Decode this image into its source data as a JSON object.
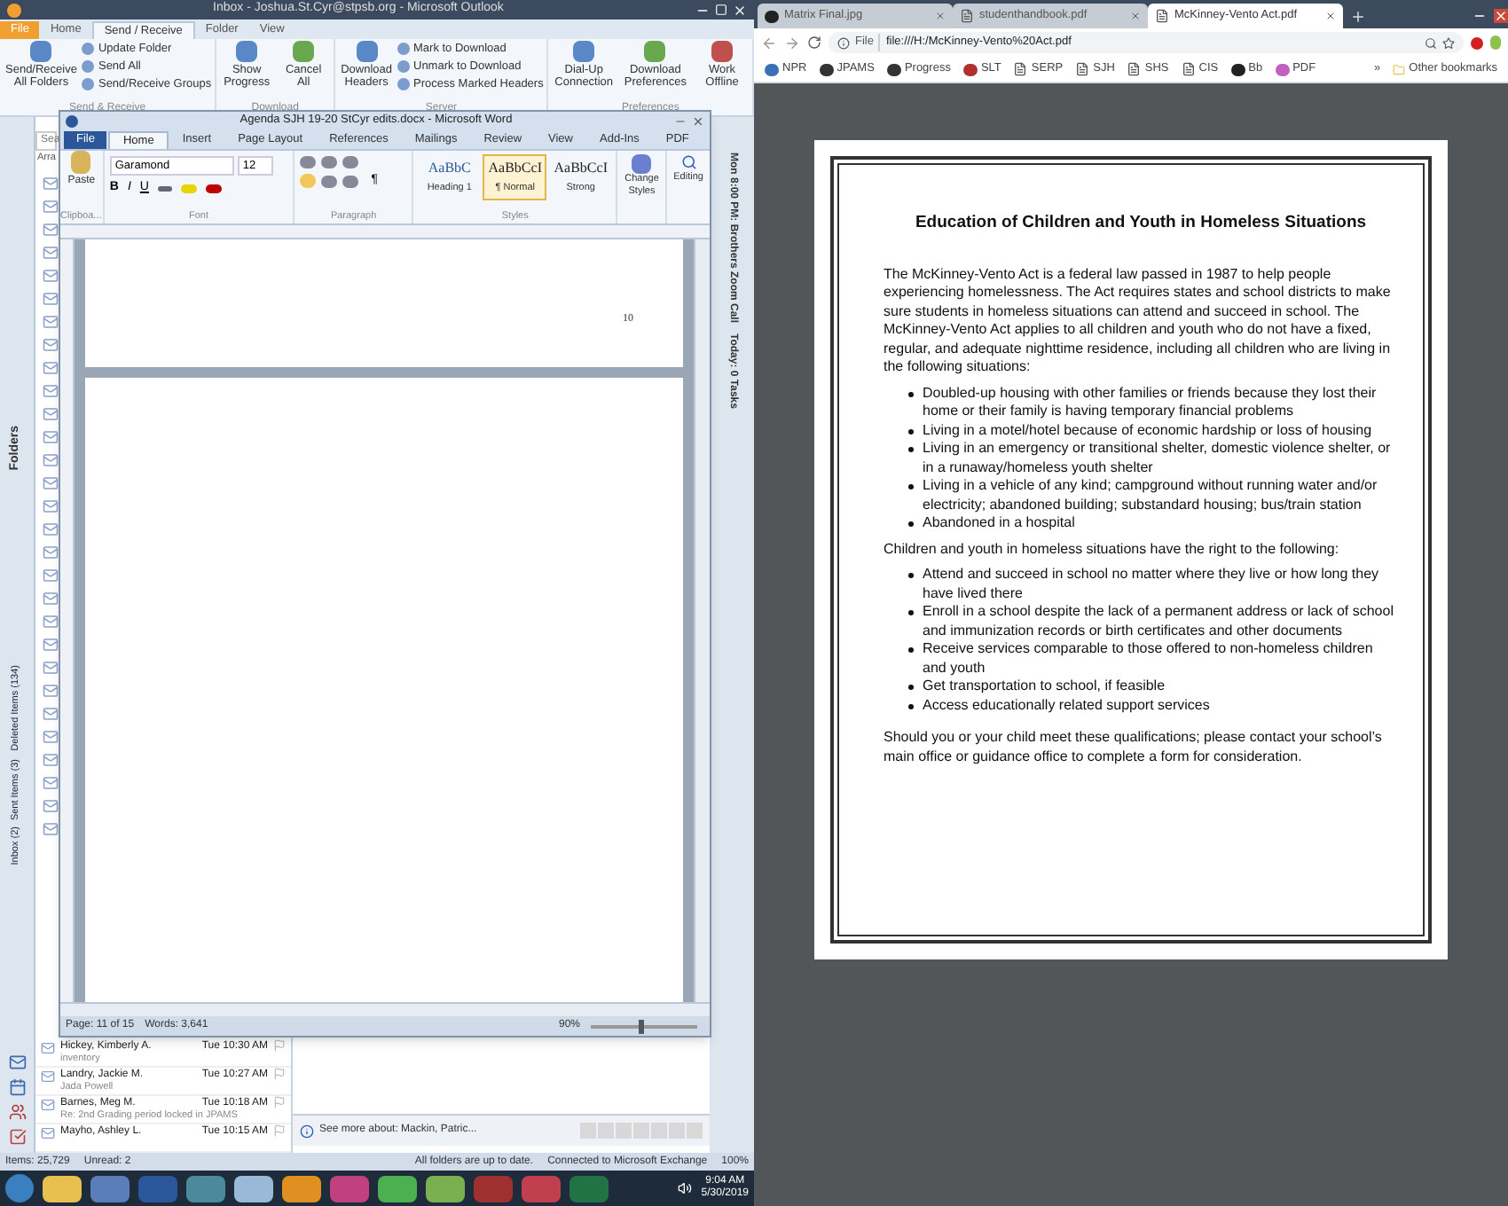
{
  "outlook": {
    "title": "Inbox - Joshua.St.Cyr@stpsb.org - Microsoft Outlook",
    "tabs": [
      {
        "label": "File",
        "kind": "file"
      },
      {
        "label": "Home",
        "selected": false,
        "kind": "tab"
      },
      {
        "label": "Send / Receive",
        "selected": true,
        "kind": "tab"
      },
      {
        "label": "Folder",
        "selected": false,
        "kind": "tab"
      },
      {
        "label": "View",
        "selected": false,
        "kind": "tab"
      }
    ],
    "ribbon_groups": [
      {
        "label": "Send & Receive",
        "buttons": [
          {
            "label": "Send/Receive All Folders",
            "kind": "large"
          },
          {
            "label": "Update Folder",
            "kind": "small"
          },
          {
            "label": "Send All",
            "kind": "small"
          },
          {
            "label": "Send/Receive Groups",
            "kind": "small"
          }
        ]
      },
      {
        "label": "Download",
        "buttons": [
          {
            "label": "Show Progress",
            "kind": "large"
          },
          {
            "label": "Cancel All",
            "kind": "large"
          }
        ]
      },
      {
        "label": "Server",
        "buttons": [
          {
            "label": "Download Headers",
            "kind": "large"
          },
          {
            "label": "Mark to Download",
            "kind": "small"
          },
          {
            "label": "Unmark to Download",
            "kind": "small"
          },
          {
            "label": "Process Marked Headers",
            "kind": "small"
          }
        ]
      },
      {
        "label": "Preferences",
        "buttons": [
          {
            "label": "Dial-Up Connection",
            "kind": "large"
          },
          {
            "label": "Download Preferences",
            "kind": "large"
          },
          {
            "label": "Work Offline",
            "kind": "large"
          }
        ]
      }
    ],
    "nav_title": "Folders",
    "favorites": [
      "Deleted Items (134)",
      "Sent Items (3)",
      "Inbox (2)"
    ],
    "search_fragment": "Sea",
    "arrange_fragment": "Arra",
    "messages": [
      {
        "sender": "Hickey, Kimberly A.",
        "time": "Tue 10:30 AM",
        "preview": "inventory"
      },
      {
        "sender": "Landry, Jackie M.",
        "time": "Tue 10:27 AM",
        "preview": "Jada Powell"
      },
      {
        "sender": "Barnes, Meg M.",
        "time": "Tue 10:18 AM",
        "preview": "Re: 2nd Grading period locked in JPAMS"
      },
      {
        "sender": "Mayho, Ashley L.",
        "time": "Tue 10:15 AM"
      }
    ],
    "people_pane": "See more about: Mackin, Patric...",
    "todo_bar": [
      "Mon 8:00 PM: Brothers Zoom Call",
      "Today: 0 Tasks"
    ],
    "status_bar": {
      "items": "Items: 25,729",
      "unread": "Unread: 2",
      "sync": "All folders are up to date.",
      "connection": "Connected to Microsoft Exchange",
      "zoom": "100%"
    }
  },
  "word": {
    "title": "Agenda SJH 19-20 StCyr edits.docx - Microsoft Word",
    "tabs": [
      {
        "label": "File",
        "kind": "file"
      },
      {
        "label": "Home",
        "selected": true,
        "kind": "tab"
      },
      {
        "label": "Insert",
        "selected": false,
        "kind": "tab"
      },
      {
        "label": "Page Layout",
        "selected": false,
        "kind": "tab"
      },
      {
        "label": "References",
        "selected": false,
        "kind": "tab"
      },
      {
        "label": "Mailings",
        "selected": false,
        "kind": "tab"
      },
      {
        "label": "Review",
        "selected": false,
        "kind": "tab"
      },
      {
        "label": "View",
        "selected": false,
        "kind": "tab"
      },
      {
        "label": "Add-Ins",
        "selected": false,
        "kind": "tab"
      },
      {
        "label": "PDF",
        "selected": false,
        "kind": "tab"
      }
    ],
    "paste": "Paste",
    "font": "Garamond",
    "size": "12",
    "format_buttons": [
      "B",
      "I",
      "U"
    ],
    "paragraph_mark": "¶",
    "styles": [
      {
        "preview": "AaBbC",
        "name": "Heading 1",
        "selected": false
      },
      {
        "preview": "AaBbCcI",
        "name": "¶ Normal",
        "selected": true
      },
      {
        "preview": "AaBbCcI",
        "name": "Strong",
        "selected": false
      }
    ],
    "change_styles": "Change Styles",
    "editing": "Editing",
    "group_labels": [
      "Clipboa...",
      "Font",
      "Paragraph",
      "Styles"
    ],
    "page_number": "10",
    "status_bar": {
      "page": "Page: 11 of 15",
      "words": "Words: 3,641",
      "zoom": "90%",
      "zoom_slider": {
        "level": 0.45
      }
    }
  },
  "taskbar": {
    "time": "9:04 AM",
    "date": "5/30/2019"
  },
  "browser": {
    "tabs": [
      {
        "label": "Matrix Final.jpg",
        "selected": false,
        "kind": "bb"
      },
      {
        "label": "studenthandbook.pdf",
        "selected": false,
        "kind": "page"
      },
      {
        "label": "McKinney-Vento Act.pdf",
        "selected": true,
        "kind": "page"
      }
    ],
    "scheme": "File",
    "url": "file:///H:/McKinney-Vento%20Act.pdf",
    "bookmarks": [
      {
        "label": "NPR",
        "kind": "npr"
      },
      {
        "label": "JPAMS",
        "kind": "grid"
      },
      {
        "label": "Progress",
        "kind": "grid"
      },
      {
        "label": "SLT",
        "kind": "school"
      },
      {
        "label": "SERP",
        "kind": "page"
      },
      {
        "label": "SJH",
        "kind": "page"
      },
      {
        "label": "SHS",
        "kind": "page"
      },
      {
        "label": "CIS",
        "kind": "page"
      },
      {
        "label": "Bb",
        "kind": "bb"
      },
      {
        "label": "PDF",
        "kind": "pdf"
      }
    ],
    "more": "»",
    "other_bookmarks": "Other bookmarks",
    "document": {
      "title": "Education of Children and Youth in Homeless Situations",
      "intro": "The McKinney-Vento Act is a federal law passed in 1987 to help people experiencing homelessness. The Act requires states and school districts to make sure students in homeless situations can attend and succeed in school. The McKinney-Vento Act applies to all children and youth who do not have a fixed, regular, and adequate nighttime residence, including all children who are living in the following situations:",
      "situations": [
        "Doubled-up housing with other families or friends because they lost their home or their family is having temporary financial problems",
        "Living in a motel/hotel because of economic hardship or loss of housing",
        "Living in an emergency or transitional shelter, domestic violence shelter, or in a runaway/homeless youth shelter",
        "Living in a vehicle of any kind; campground without running water and/or electricity; abandoned building; substandard housing; bus/train station",
        "Abandoned in a hospital"
      ],
      "rights_intro": "Children and youth in homeless situations have the right to the following:",
      "rights": [
        "Attend and succeed in school no matter where they live or how long they have lived there",
        "Enroll in a school despite the lack of a permanent address or lack of school and immunization records or birth certificates and other documents",
        "Receive services comparable to those offered to non-homeless children and youth",
        "Get transportation to school, if feasible",
        "Access educationally related support services"
      ],
      "closing": "Should you or your child meet these qualifications; please contact your school’s main office or guidance office to complete a form for consideration."
    }
  }
}
